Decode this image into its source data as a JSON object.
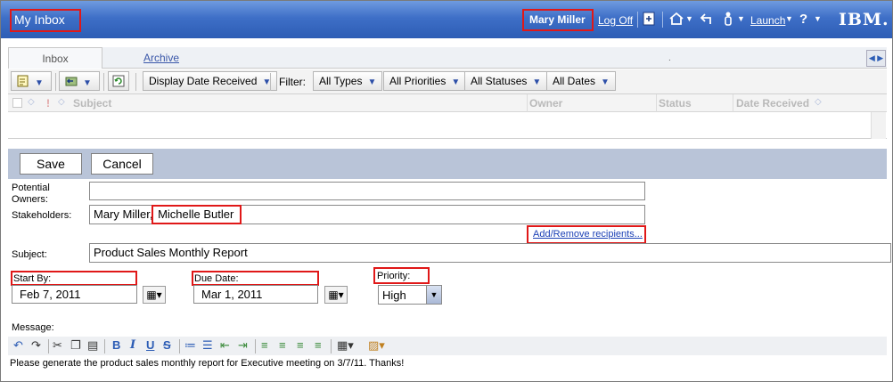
{
  "header": {
    "title": "My Inbox",
    "user": "Mary Miller",
    "logoff": "Log Off",
    "launch": "Launch",
    "brand": "IBM.",
    "icons": [
      "export-icon",
      "home-icon",
      "back-icon",
      "person-icon",
      "help-icon"
    ]
  },
  "tabs": [
    {
      "label": "Inbox",
      "active": true
    },
    {
      "label": "Archive",
      "active": false
    }
  ],
  "tab_dot": ".",
  "toolbar": {
    "display_sort": "Display Date Received",
    "filter_label": "Filter:",
    "filters": [
      "All Types",
      "All Priorities",
      "All Statuses",
      "All Dates"
    ]
  },
  "grid": {
    "columns": [
      "Subject",
      "Owner",
      "Status",
      "Date Received"
    ]
  },
  "form": {
    "save": "Save",
    "cancel": "Cancel",
    "potential_owners_label": "Potential Owners:",
    "potential_owners_value": "",
    "stakeholders_label": "Stakeholders:",
    "stakeholders": [
      "Mary Miller,",
      "Michelle Butler"
    ],
    "add_remove_link": "Add/Remove recipients...",
    "subject_label": "Subject:",
    "subject_value": "Product Sales Monthly Report",
    "start_by_label": "Start By:",
    "start_by_value": "Feb 7, 2011",
    "due_date_label": "Due Date:",
    "due_date_value": "Mar 1, 2011",
    "priority_label": "Priority:",
    "priority_value": "High",
    "message_label": "Message:",
    "message_body": "Please generate the product sales monthly report for Executive meeting on 3/7/11. Thanks!"
  },
  "colors": {
    "banner": "#3e6fc7",
    "highlight": "#e01818",
    "form_bar": "#b9c4d8",
    "link": "#1a3fb5"
  }
}
